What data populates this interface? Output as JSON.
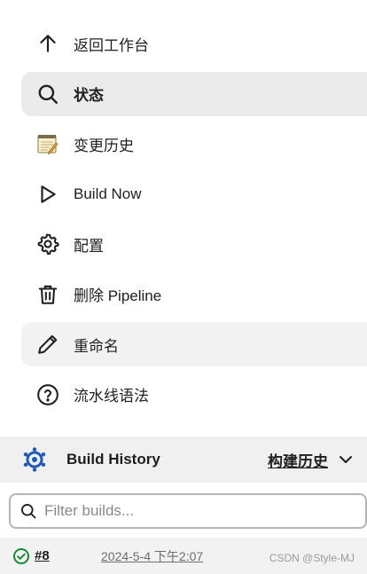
{
  "menu": {
    "items": [
      {
        "label": "返回工作台",
        "icon": "arrow-up-icon"
      },
      {
        "label": "状态",
        "icon": "search-icon"
      },
      {
        "label": "变更历史",
        "icon": "notepad-icon"
      },
      {
        "label": "Build Now",
        "icon": "play-icon"
      },
      {
        "label": "配置",
        "icon": "gear-icon"
      },
      {
        "label": "删除 Pipeline",
        "icon": "trash-icon"
      },
      {
        "label": "重命名",
        "icon": "pencil-icon"
      },
      {
        "label": "流水线语法",
        "icon": "help-icon"
      }
    ]
  },
  "build_history": {
    "title": "Build History",
    "trend_label": "构建历史",
    "search_placeholder": "Filter builds...",
    "builds": [
      {
        "number": "#8",
        "time": "2024-5-4 下午2:07",
        "status": "success"
      }
    ]
  },
  "watermark": "CSDN @Style-MJ",
  "colors": {
    "active_bg": "#ebebeb",
    "success": "#138a36",
    "jenkins_blue": "#1e5bb8"
  }
}
